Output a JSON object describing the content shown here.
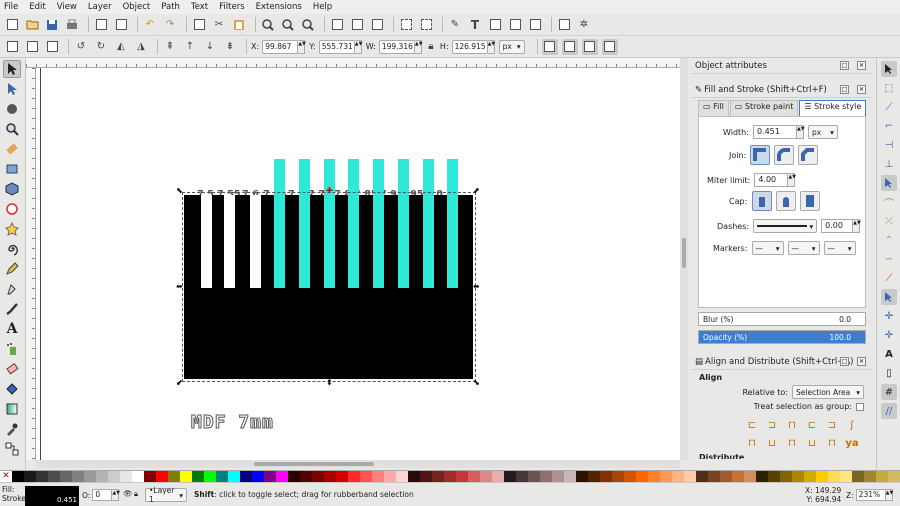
{
  "menu": [
    "File",
    "Edit",
    "View",
    "Layer",
    "Object",
    "Path",
    "Text",
    "Filters",
    "Extensions",
    "Help"
  ],
  "controls": {
    "x_label": "X:",
    "x": "99.867",
    "y_label": "Y:",
    "y": "555.731",
    "w_label": "W:",
    "w": "199.316",
    "h_label": "H:",
    "h": "126.915",
    "unit": "px"
  },
  "canvas": {
    "scale_labels": [
      "7.5",
      "7.55",
      "7.6",
      "7.65",
      "7.7",
      "7.75",
      "7.8",
      "7.85",
      "7.9",
      "7.95",
      "8.0"
    ],
    "caption": "MDF 7mm",
    "cyan": "#2ee8d8"
  },
  "dock": {
    "object_attributes": "Object attributes",
    "fill_stroke_title": "Fill and Stroke (Shift+Ctrl+F)",
    "tabs": [
      "Fill",
      "Stroke paint",
      "Stroke style"
    ],
    "width_label": "Width:",
    "width": "0.451",
    "width_unit": "px",
    "join_label": "Join:",
    "miter_label": "Miter limit:",
    "miter": "4.00",
    "cap_label": "Cap:",
    "dashes_label": "Dashes:",
    "dashes": "0.00",
    "markers_label": "Markers:",
    "blur_label": "Blur (%)",
    "blur": "0.0",
    "opacity_label": "Opacity (%)",
    "opacity": "100.0",
    "align_title": "Align and Distribute (Shift+Ctrl+A)",
    "align_label": "Align",
    "relative_label": "Relative to:",
    "relative": "Selection Area",
    "treat_group": "Treat selection as group:",
    "distribute_label": "Distribute"
  },
  "status": {
    "fill_label": "Fill:",
    "stroke_label": "Stroke:",
    "stroke_width": "0.451",
    "opacity_label": "O:",
    "opacity": "0",
    "layer": "•Layer 1",
    "message_bold": "Shift",
    "message": ": click to toggle select; drag for rubberband selection",
    "coord_x_label": "X:",
    "coord_x": "149.29",
    "coord_y_label": "Y:",
    "coord_y": "694.94",
    "zoom_label": "Z:",
    "zoom": "231%"
  }
}
